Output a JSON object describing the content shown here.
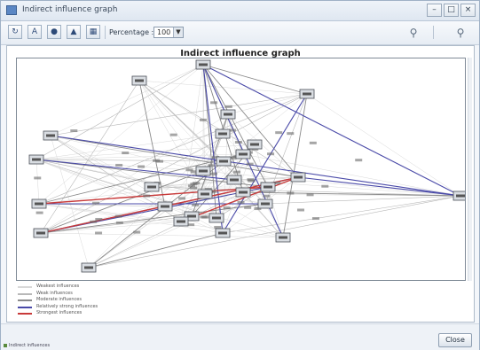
{
  "window": {
    "title": "Indirect influence graph",
    "minimize_glyph": "–",
    "maximize_glyph": "□",
    "close_glyph": "×"
  },
  "toolbar": {
    "buttons": [
      {
        "name": "refresh-icon",
        "glyph": "↻"
      },
      {
        "name": "export-icon",
        "glyph": "A"
      },
      {
        "name": "settings-icon",
        "glyph": "●"
      },
      {
        "name": "layout-icon",
        "glyph": "▲"
      },
      {
        "name": "print-icon",
        "glyph": "▦"
      }
    ],
    "percentage_label": "Percentage :",
    "percentage_value": "100",
    "percentage_arrow": "▼",
    "zoom_in_glyph": "⚲",
    "zoom_out_glyph": "⚲"
  },
  "graph": {
    "title": "Indirect influence graph",
    "edge_colors": {
      "weakest": "#d8d8d8",
      "weak": "#b8b8b8",
      "moderate": "#8a8a8a",
      "relatively_strong": "#4a4aa8",
      "strongest": "#c83a3a"
    }
  },
  "legend": [
    {
      "label": "Weakest influences",
      "color": "#d8d8d8"
    },
    {
      "label": "Weak influences",
      "color": "#b8b8b8"
    },
    {
      "label": "Moderate influences",
      "color": "#8a8a8a"
    },
    {
      "label": "Relatively strong influences",
      "color": "#4a4aa8"
    },
    {
      "label": "Strongest influences",
      "color": "#c83a3a"
    }
  ],
  "status": {
    "text": "Indirect influences",
    "close_label": "Close"
  }
}
